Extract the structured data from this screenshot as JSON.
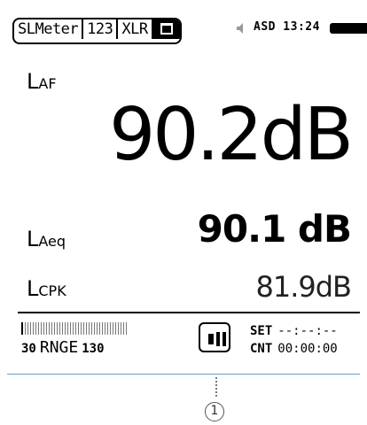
{
  "statusbar": {
    "tabs": [
      "SLMeter",
      "123",
      "XLR"
    ],
    "status_text": "ASD 13:24",
    "icons": [
      "memory-card-icon",
      "speaker-icon",
      "battery-icon"
    ]
  },
  "readings": {
    "laf": {
      "label_main": "L",
      "label_sub": "AF",
      "value": "90.2dB"
    },
    "laeq": {
      "label_main": "L",
      "label_sub": "Aeq",
      "value": "90.1 dB"
    },
    "lcpk": {
      "label_main": "L",
      "label_sub": "CPK",
      "value": "81.9dB"
    }
  },
  "bottom": {
    "range_low": "30",
    "range_label": "RNGE",
    "range_high": "130",
    "set_label": "SET",
    "set_value": "--:--:--",
    "cnt_label": "CNT",
    "cnt_value": "00:00:00"
  },
  "callout": {
    "number": "1"
  }
}
